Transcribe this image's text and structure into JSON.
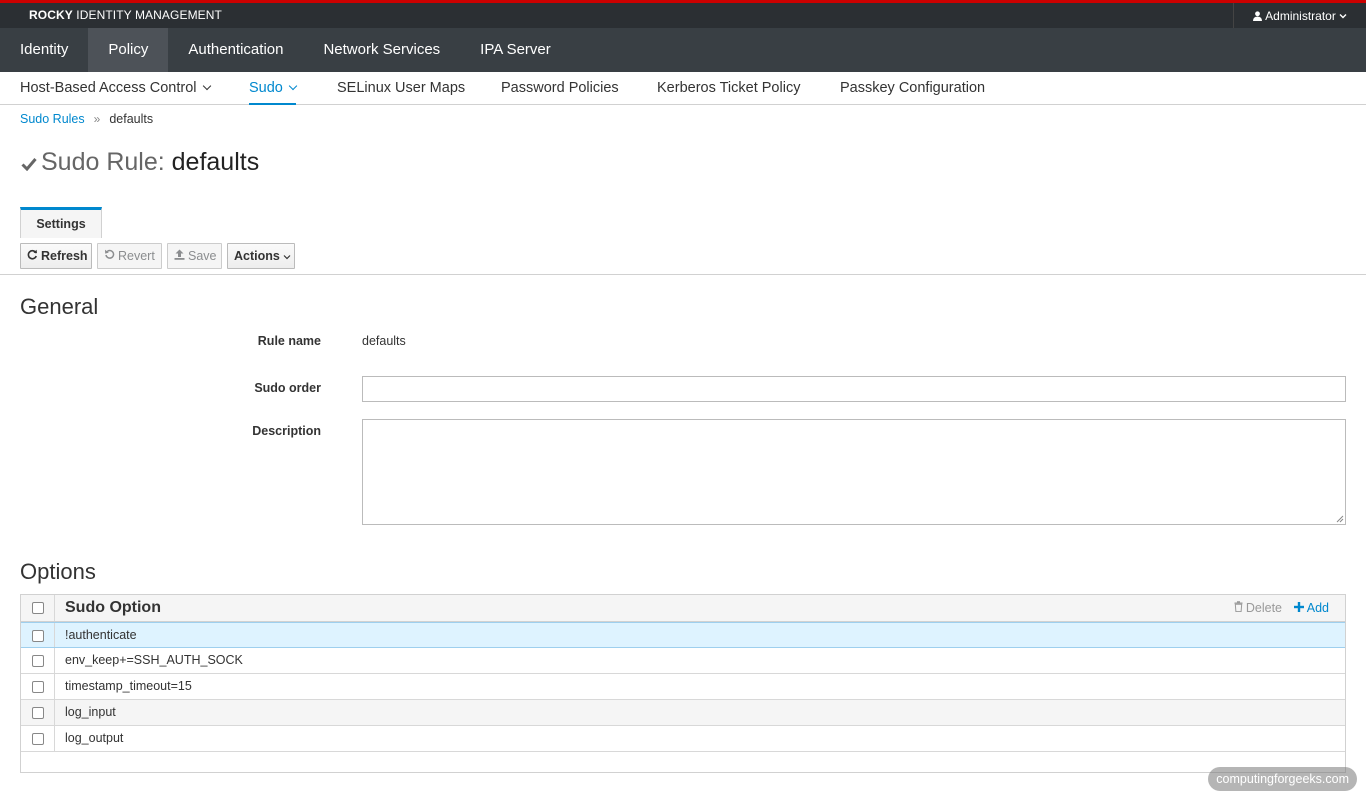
{
  "header": {
    "brand_bold": "ROCKY",
    "brand_rest": " IDENTITY MANAGEMENT",
    "user": "Administrator",
    "accent": "#cc0000"
  },
  "main_nav": [
    "Identity",
    "Policy",
    "Authentication",
    "Network Services",
    "IPA Server"
  ],
  "main_nav_active": "Policy",
  "sub_nav": {
    "hbac": "Host-Based Access Control",
    "sudo": "Sudo",
    "selinux": "SELinux User Maps",
    "password": "Password Policies",
    "kerberos": "Kerberos Ticket Policy",
    "passkey": "Passkey Configuration",
    "active": "Sudo"
  },
  "breadcrumb": {
    "parent": "Sudo Rules",
    "separator": "»",
    "current": "defaults"
  },
  "page_title": {
    "prefix": "Sudo Rule: ",
    "name": "defaults"
  },
  "tabs": {
    "settings": "Settings"
  },
  "toolbar": {
    "refresh": "Refresh",
    "revert": "Revert",
    "save": "Save",
    "actions": "Actions"
  },
  "general": {
    "heading": "General",
    "rule_name_label": "Rule name",
    "rule_name_value": "defaults",
    "sudo_order_label": "Sudo order",
    "sudo_order_value": "",
    "description_label": "Description",
    "description_value": ""
  },
  "options": {
    "heading": "Options",
    "column": "Sudo Option",
    "delete": "Delete",
    "add": "Add",
    "rows": [
      "!authenticate",
      "env_keep+=SSH_AUTH_SOCK",
      "timestamp_timeout=15",
      "log_input",
      "log_output"
    ],
    "selected_row": "!authenticate"
  },
  "watermark": "computingforgeeks.com",
  "colors": {
    "link": "#0088ce",
    "nav_bg": "#393f44",
    "topbar_bg": "#2b2f33",
    "selected_row": "#def3ff"
  }
}
